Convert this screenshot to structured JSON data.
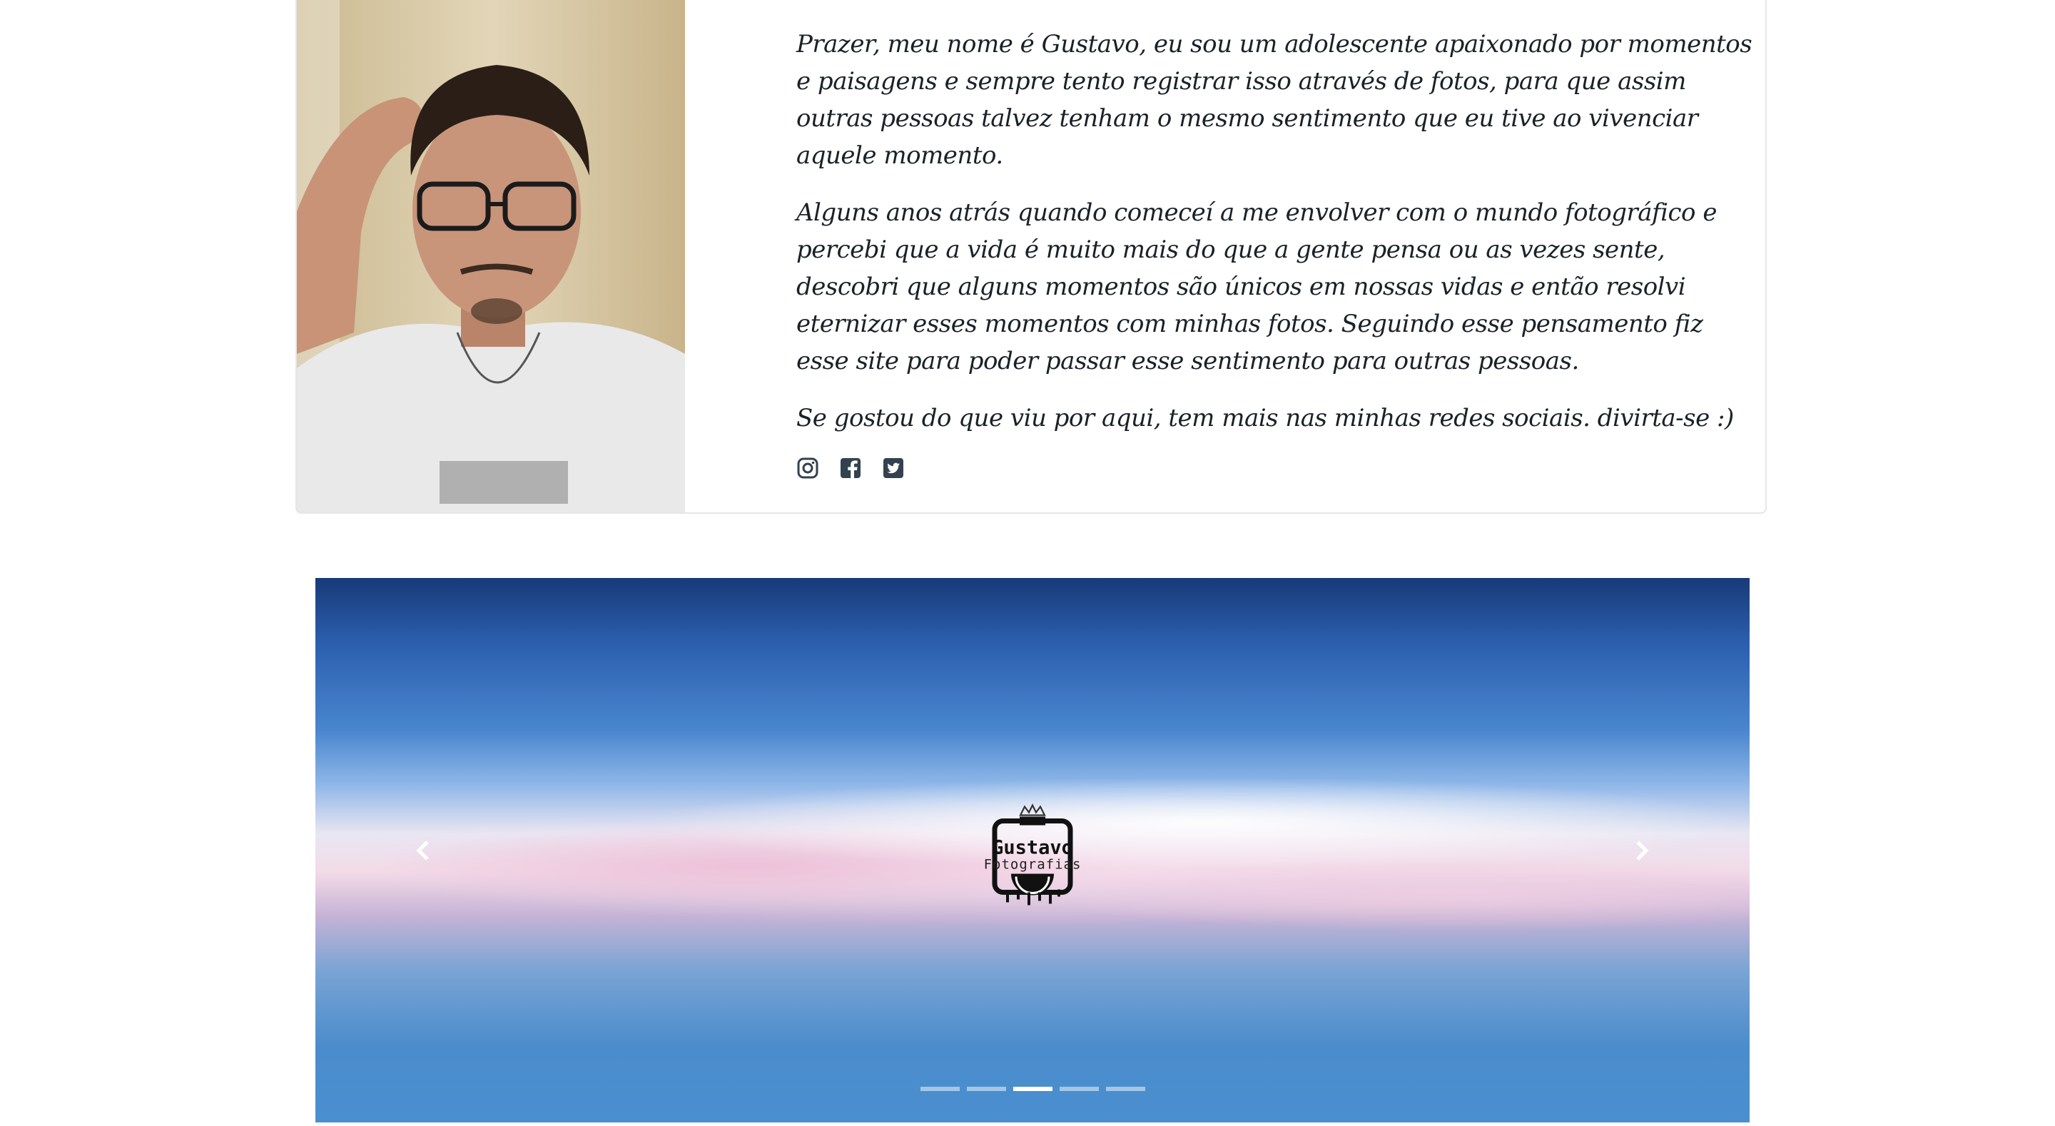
{
  "about": {
    "paragraphs": [
      "Prazer, meu nome é Gustavo, eu sou um adolescente apaixonado por momentos e paisagens e sempre tento registrar isso através de fotos, para que assim outras pessoas talvez tenham o mesmo sentimento que eu tive ao vivenciar aquele momento.",
      "Alguns anos atrás quando comeceí a me envolver com o mundo fotográfico e percebi que a vida é muito mais do que a gente pensa ou as vezes sente, descobri que alguns momentos são únicos em nossas vidas e então resolvi eternizar esses momentos com minhas fotos. Seguindo esse pensamento fiz esse site para poder passar esse sentimento para outras pessoas.",
      "Se gostou do que viu por aqui, tem mais nas minhas redes sociais. divirta-se :)"
    ],
    "social": [
      {
        "icon": "instagram-icon"
      },
      {
        "icon": "facebook-icon"
      },
      {
        "icon": "twitter-icon"
      }
    ]
  },
  "carousel": {
    "logo_line1": "Gustavo",
    "logo_line2": "Fotografias",
    "indicator_count": 5,
    "active_index": 2,
    "prev_icon": "chevron-left-icon",
    "next_icon": "chevron-right-icon"
  },
  "colors": {
    "text": "#1b2127",
    "icon": "#33424f"
  }
}
